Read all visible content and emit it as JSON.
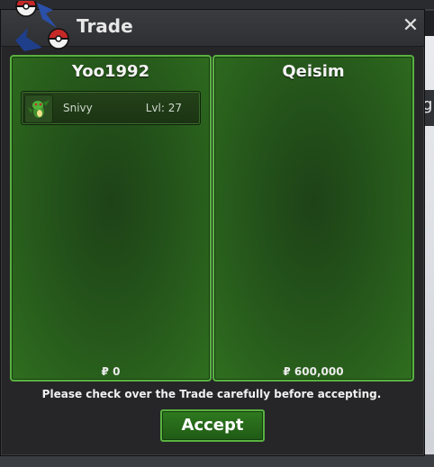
{
  "dialog": {
    "title": "Trade",
    "close_glyph": "✕"
  },
  "background": {
    "partial_text": "g"
  },
  "left_panel": {
    "player": "Yoo1992",
    "items": [
      {
        "name": "Snivy",
        "level": "Lvl: 27",
        "icon": "snivy-icon"
      }
    ],
    "money": "₽ 0"
  },
  "right_panel": {
    "player": "Qeisim",
    "items": [],
    "money": "₽ 600,000"
  },
  "footer": {
    "notice": "Please check over the Trade carefully before accepting.",
    "accept_label": "Accept"
  },
  "colors": {
    "panel_border": "#59b241",
    "panel_fill": "#26581b",
    "dialog_bg": "#262628",
    "accent_red": "#c62828",
    "accent_blue": "#1f3f8a"
  }
}
